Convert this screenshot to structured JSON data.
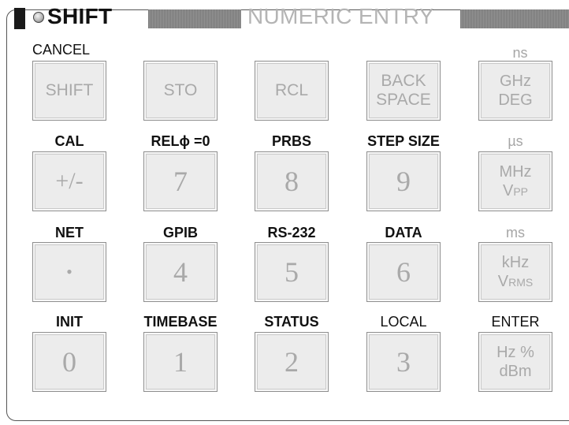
{
  "header": {
    "shift_label": "SHIFT",
    "section_title": "NUMERIC ENTRY"
  },
  "colors": {
    "key_face": "#ececec",
    "key_text": "#a9a9a9",
    "title_gray": "#b4b4b4",
    "header_bar": "#8a8a8a"
  },
  "row1": {
    "labels": [
      "CANCEL",
      "",
      "",
      "",
      "ns"
    ],
    "keys": [
      "SHIFT",
      "STO",
      "RCL",
      "BACK",
      "SPACE",
      "GHz",
      "DEG"
    ]
  },
  "row2": {
    "labels": [
      "CAL",
      "RELϕ =0",
      "PRBS",
      "STEP SIZE",
      "µs"
    ],
    "keys": [
      "+/-",
      "7",
      "8",
      "9",
      "MHz",
      "V",
      "PP"
    ]
  },
  "row3": {
    "labels": [
      "NET",
      "GPIB",
      "RS-232",
      "DATA",
      "ms"
    ],
    "keys": [
      "•",
      "4",
      "5",
      "6",
      "kHz",
      "V",
      "RMS"
    ]
  },
  "row4": {
    "labels": [
      "INIT",
      "TIMEBASE",
      "STATUS",
      "LOCAL",
      "ENTER"
    ],
    "keys": [
      "0",
      "1",
      "2",
      "3",
      "Hz %",
      "dBm"
    ]
  }
}
